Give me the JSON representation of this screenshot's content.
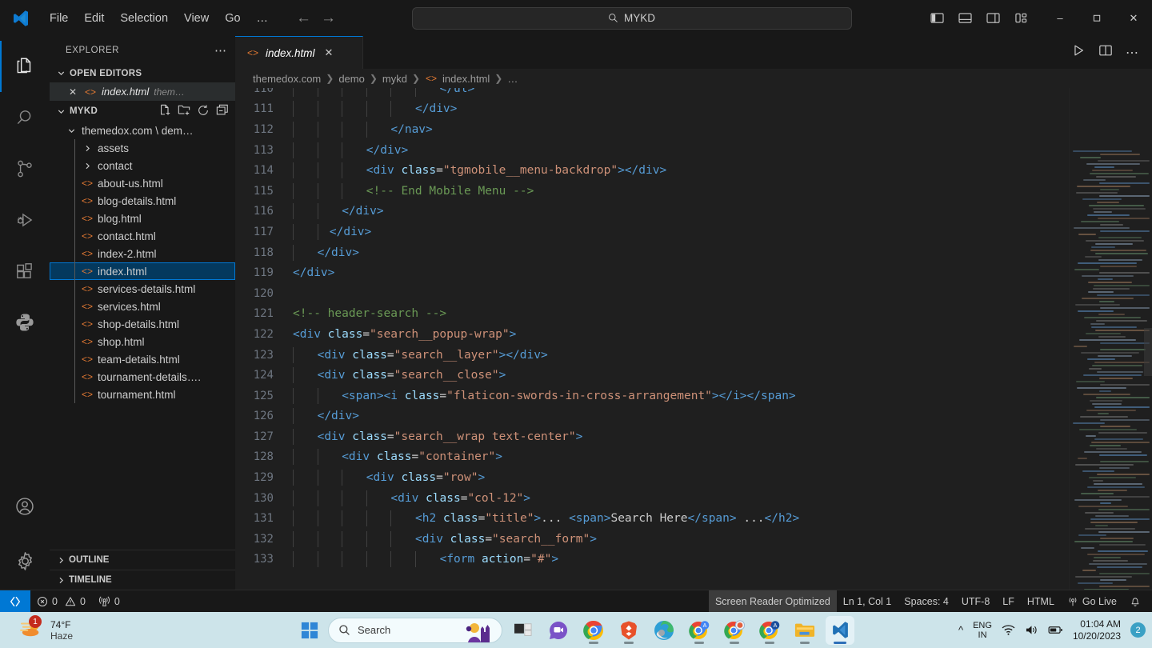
{
  "titlebar": {
    "logo_icon": "vscode-logo-icon",
    "menus": [
      "File",
      "Edit",
      "Selection",
      "View",
      "Go",
      "…"
    ],
    "nav_back_icon": "arrow-left-icon",
    "nav_forward_icon": "arrow-right-icon",
    "quick_open": {
      "icon": "search-icon",
      "value": "MYKD"
    },
    "layout_icons": [
      "toggle-primary-sidebar-icon",
      "toggle-panel-icon",
      "toggle-secondary-sidebar-icon",
      "customize-layout-icon"
    ],
    "window_controls": {
      "minimize": "–",
      "maximize": "❐",
      "close": "✕"
    }
  },
  "activitybar": {
    "items": [
      {
        "name": "explorer",
        "icon": "files-icon",
        "active": true
      },
      {
        "name": "search",
        "icon": "search-icon",
        "active": false
      },
      {
        "name": "source-control",
        "icon": "source-control-icon",
        "active": false
      },
      {
        "name": "run-and-debug",
        "icon": "run-debug-icon",
        "active": false
      },
      {
        "name": "extensions",
        "icon": "extensions-icon",
        "active": false
      },
      {
        "name": "python",
        "icon": "python-icon",
        "active": false
      }
    ],
    "bottom_items": [
      {
        "name": "accounts",
        "icon": "account-icon"
      },
      {
        "name": "settings",
        "icon": "gear-icon"
      }
    ]
  },
  "sidebar": {
    "title": "EXPLORER",
    "more_actions_icon": "ellipsis-icon",
    "open_editors": {
      "label": "OPEN EDITORS",
      "chevron": "chevron-down-icon",
      "items": [
        {
          "close_icon": "close-icon",
          "file_icon": "html-file-icon",
          "name": "index.html",
          "description": "them…"
        }
      ]
    },
    "workspace": {
      "label": "MYKD",
      "chevron": "chevron-down-icon",
      "actions": [
        "new-file-icon",
        "new-folder-icon",
        "refresh-icon",
        "collapse-all-icon"
      ]
    },
    "tree": [
      {
        "label": "themedox.com \\ dem…",
        "type": "folder",
        "expanded": true,
        "depth": 1,
        "chevron": "chevron-down-icon"
      },
      {
        "label": "assets",
        "type": "folder",
        "expanded": false,
        "depth": 2,
        "chevron": "chevron-right-icon"
      },
      {
        "label": "contact",
        "type": "folder",
        "expanded": false,
        "depth": 2,
        "chevron": "chevron-right-icon"
      },
      {
        "label": "about-us.html",
        "type": "file",
        "depth": 2,
        "icon": "html-file-icon"
      },
      {
        "label": "blog-details.html",
        "type": "file",
        "depth": 2,
        "icon": "html-file-icon"
      },
      {
        "label": "blog.html",
        "type": "file",
        "depth": 2,
        "icon": "html-file-icon"
      },
      {
        "label": "contact.html",
        "type": "file",
        "depth": 2,
        "icon": "html-file-icon"
      },
      {
        "label": "index-2.html",
        "type": "file",
        "depth": 2,
        "icon": "html-file-icon"
      },
      {
        "label": "index.html",
        "type": "file",
        "depth": 2,
        "icon": "html-file-icon",
        "selected": true
      },
      {
        "label": "services-details.html",
        "type": "file",
        "depth": 2,
        "icon": "html-file-icon"
      },
      {
        "label": "services.html",
        "type": "file",
        "depth": 2,
        "icon": "html-file-icon"
      },
      {
        "label": "shop-details.html",
        "type": "file",
        "depth": 2,
        "icon": "html-file-icon"
      },
      {
        "label": "shop.html",
        "type": "file",
        "depth": 2,
        "icon": "html-file-icon"
      },
      {
        "label": "team-details.html",
        "type": "file",
        "depth": 2,
        "icon": "html-file-icon"
      },
      {
        "label": "tournament-details….",
        "type": "file",
        "depth": 2,
        "icon": "html-file-icon"
      },
      {
        "label": "tournament.html",
        "type": "file",
        "depth": 2,
        "icon": "html-file-icon"
      }
    ],
    "bottom_sections": [
      {
        "label": "OUTLINE",
        "chevron": "chevron-right-icon"
      },
      {
        "label": "TIMELINE",
        "chevron": "chevron-right-icon"
      }
    ]
  },
  "editor": {
    "tab": {
      "icon": "html-file-icon",
      "label": "index.html",
      "close_icon": "close-icon"
    },
    "actions": [
      "run-file-icon",
      "split-editor-icon",
      "more-actions-icon"
    ],
    "breadcrumb": [
      {
        "label": "themedox.com"
      },
      {
        "label": "demo"
      },
      {
        "label": "mykd"
      },
      {
        "label": "index.html",
        "icon": "html-file-icon"
      },
      {
        "label": "…"
      }
    ],
    "first_line_number": 110,
    "lines": [
      {
        "n": 110,
        "indent": 6,
        "tokens": [
          {
            "c": "t-tag",
            "t": "</ul>"
          }
        ]
      },
      {
        "n": 111,
        "indent": 5,
        "tokens": [
          {
            "c": "t-tag",
            "t": "</div>"
          }
        ]
      },
      {
        "n": 112,
        "indent": 4,
        "tokens": [
          {
            "c": "t-tag",
            "t": "</nav>"
          }
        ]
      },
      {
        "n": 113,
        "indent": 3,
        "tokens": [
          {
            "c": "t-tag",
            "t": "</div>"
          }
        ]
      },
      {
        "n": 114,
        "indent": 3,
        "tokens": [
          {
            "c": "t-tag",
            "t": "<div "
          },
          {
            "c": "t-attr",
            "t": "class"
          },
          {
            "c": "t-eq",
            "t": "="
          },
          {
            "c": "t-str",
            "t": "\"tgmobile__menu-backdrop\""
          },
          {
            "c": "t-tag",
            "t": "></div>"
          }
        ]
      },
      {
        "n": 115,
        "indent": 3,
        "tokens": [
          {
            "c": "t-com",
            "t": "<!-- End Mobile Menu -->"
          }
        ]
      },
      {
        "n": 116,
        "indent": 2,
        "tokens": [
          {
            "c": "t-tag",
            "t": "</div>"
          }
        ]
      },
      {
        "n": 117,
        "indent": 1.5,
        "tokens": [
          {
            "c": "t-tag",
            "t": "</div>"
          }
        ]
      },
      {
        "n": 118,
        "indent": 1,
        "tokens": [
          {
            "c": "t-tag",
            "t": "</div>"
          }
        ]
      },
      {
        "n": 119,
        "indent": 0,
        "tokens": [
          {
            "c": "t-tag",
            "t": "</div>"
          }
        ]
      },
      {
        "n": 120,
        "indent": 0,
        "tokens": []
      },
      {
        "n": 121,
        "indent": 0,
        "tokens": [
          {
            "c": "t-com",
            "t": "<!-- header-search -->"
          }
        ]
      },
      {
        "n": 122,
        "indent": 0,
        "tokens": [
          {
            "c": "t-tag",
            "t": "<div "
          },
          {
            "c": "t-attr",
            "t": "class"
          },
          {
            "c": "t-eq",
            "t": "="
          },
          {
            "c": "t-str",
            "t": "\"search__popup-wrap\""
          },
          {
            "c": "t-tag",
            "t": ">"
          }
        ]
      },
      {
        "n": 123,
        "indent": 1,
        "tokens": [
          {
            "c": "t-tag",
            "t": "<div "
          },
          {
            "c": "t-attr",
            "t": "class"
          },
          {
            "c": "t-eq",
            "t": "="
          },
          {
            "c": "t-str",
            "t": "\"search__layer\""
          },
          {
            "c": "t-tag",
            "t": "></div>"
          }
        ]
      },
      {
        "n": 124,
        "indent": 1,
        "tokens": [
          {
            "c": "t-tag",
            "t": "<div "
          },
          {
            "c": "t-attr",
            "t": "class"
          },
          {
            "c": "t-eq",
            "t": "="
          },
          {
            "c": "t-str",
            "t": "\"search__close\""
          },
          {
            "c": "t-tag",
            "t": ">"
          }
        ]
      },
      {
        "n": 125,
        "indent": 2,
        "tokens": [
          {
            "c": "t-tag",
            "t": "<span><i "
          },
          {
            "c": "t-attr",
            "t": "class"
          },
          {
            "c": "t-eq",
            "t": "="
          },
          {
            "c": "t-str",
            "t": "\"flaticon-swords-in-cross-arrangement\""
          },
          {
            "c": "t-tag",
            "t": "></i></span>"
          }
        ]
      },
      {
        "n": 126,
        "indent": 1,
        "tokens": [
          {
            "c": "t-tag",
            "t": "</div>"
          }
        ]
      },
      {
        "n": 127,
        "indent": 1,
        "tokens": [
          {
            "c": "t-tag",
            "t": "<div "
          },
          {
            "c": "t-attr",
            "t": "class"
          },
          {
            "c": "t-eq",
            "t": "="
          },
          {
            "c": "t-str",
            "t": "\"search__wrap text-center\""
          },
          {
            "c": "t-tag",
            "t": ">"
          }
        ]
      },
      {
        "n": 128,
        "indent": 2,
        "tokens": [
          {
            "c": "t-tag",
            "t": "<div "
          },
          {
            "c": "t-attr",
            "t": "class"
          },
          {
            "c": "t-eq",
            "t": "="
          },
          {
            "c": "t-str",
            "t": "\"container\""
          },
          {
            "c": "t-tag",
            "t": ">"
          }
        ]
      },
      {
        "n": 129,
        "indent": 3,
        "tokens": [
          {
            "c": "t-tag",
            "t": "<div "
          },
          {
            "c": "t-attr",
            "t": "class"
          },
          {
            "c": "t-eq",
            "t": "="
          },
          {
            "c": "t-str",
            "t": "\"row\""
          },
          {
            "c": "t-tag",
            "t": ">"
          }
        ]
      },
      {
        "n": 130,
        "indent": 4,
        "tokens": [
          {
            "c": "t-tag",
            "t": "<div "
          },
          {
            "c": "t-attr",
            "t": "class"
          },
          {
            "c": "t-eq",
            "t": "="
          },
          {
            "c": "t-str",
            "t": "\"col-12\""
          },
          {
            "c": "t-tag",
            "t": ">"
          }
        ]
      },
      {
        "n": 131,
        "indent": 5,
        "tokens": [
          {
            "c": "t-tag",
            "t": "<h2 "
          },
          {
            "c": "t-attr",
            "t": "class"
          },
          {
            "c": "t-eq",
            "t": "="
          },
          {
            "c": "t-str",
            "t": "\"title\""
          },
          {
            "c": "t-tag",
            "t": ">"
          },
          {
            "c": "t-txt",
            "t": "... "
          },
          {
            "c": "t-tag",
            "t": "<span>"
          },
          {
            "c": "t-txt",
            "t": "Search Here"
          },
          {
            "c": "t-tag",
            "t": "</span>"
          },
          {
            "c": "t-txt",
            "t": " ..."
          },
          {
            "c": "t-tag",
            "t": "</h2>"
          }
        ]
      },
      {
        "n": 132,
        "indent": 5,
        "tokens": [
          {
            "c": "t-tag",
            "t": "<div "
          },
          {
            "c": "t-attr",
            "t": "class"
          },
          {
            "c": "t-eq",
            "t": "="
          },
          {
            "c": "t-str",
            "t": "\"search__form\""
          },
          {
            "c": "t-tag",
            "t": ">"
          }
        ]
      },
      {
        "n": 133,
        "indent": 6,
        "tokens": [
          {
            "c": "t-tag",
            "t": "<form "
          },
          {
            "c": "t-attr",
            "t": "action"
          },
          {
            "c": "t-eq",
            "t": "="
          },
          {
            "c": "t-str",
            "t": "\"#\""
          },
          {
            "c": "t-tag",
            "t": ">"
          }
        ]
      }
    ]
  },
  "statusbar": {
    "remote_icon": "remote-window-icon",
    "problems": {
      "error_icon": "error-icon",
      "errors": "0",
      "warning_icon": "warning-icon",
      "warnings": "0"
    },
    "ports": {
      "icon": "radio-tower-icon",
      "count": "0"
    },
    "screen_reader": "Screen Reader Optimized",
    "cursor_position": "Ln 1, Col 1",
    "indentation": "Spaces: 4",
    "encoding": "UTF-8",
    "eol": "LF",
    "language": "HTML",
    "go_live": {
      "icon": "broadcast-icon",
      "label": "Go Live"
    },
    "notifications_icon": "bell-icon"
  },
  "taskbar": {
    "weather": {
      "temperature": "74°F",
      "condition": "Haze",
      "badge": "1",
      "icon": "haze-icon"
    },
    "start_icon": "windows-start-icon",
    "search": {
      "icon": "search-icon",
      "placeholder": "Search",
      "decoration_icon": "castle-moon-icon"
    },
    "apps": [
      {
        "name": "task-view",
        "icon": "task-view-icon",
        "running": false,
        "active": false
      },
      {
        "name": "chat",
        "icon": "chat-video-icon",
        "running": false,
        "active": false
      },
      {
        "name": "google-chrome",
        "icon": "chrome-icon",
        "running": true,
        "active": false
      },
      {
        "name": "brave-browser",
        "icon": "brave-icon",
        "running": true,
        "active": false
      },
      {
        "name": "microsoft-edge",
        "icon": "edge-icon",
        "running": false,
        "active": false
      },
      {
        "name": "chrome-profile-a",
        "icon": "chrome-profile-icon",
        "running": true,
        "active": false
      },
      {
        "name": "chrome-profile-b",
        "icon": "chrome-profile-icon",
        "running": true,
        "active": false
      },
      {
        "name": "chrome-profile-c",
        "icon": "chrome-profile-icon",
        "running": true,
        "active": false
      },
      {
        "name": "file-explorer",
        "icon": "folder-icon",
        "running": true,
        "active": false
      },
      {
        "name": "visual-studio-code",
        "icon": "vscode-icon",
        "running": true,
        "active": true
      }
    ],
    "tray": {
      "overflow_icon": "chevron-up-icon",
      "language": "ENG",
      "language_region": "IN",
      "wifi_icon": "wifi-icon",
      "volume_icon": "speaker-icon",
      "battery_icon": "battery-icon",
      "time": "01:04 AM",
      "date": "10/20/2023",
      "notification_count": "2"
    }
  },
  "colors": {
    "accent": "#0078d4",
    "html_file": "#e37933",
    "selection": "#04395e",
    "taskbar_bg": "#cde4ea"
  }
}
